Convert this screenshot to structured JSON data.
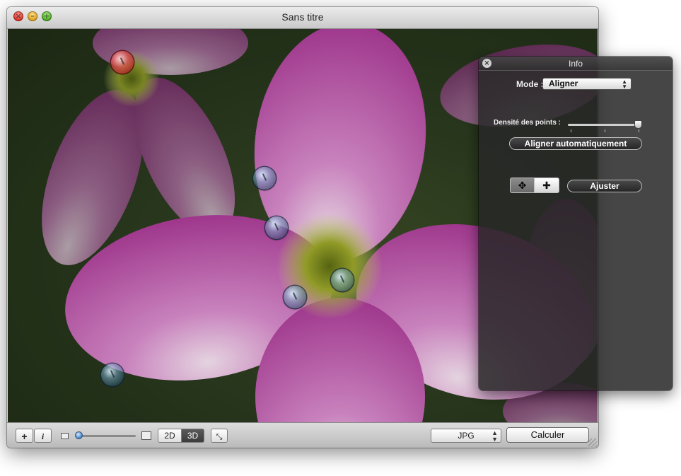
{
  "window": {
    "title": "Sans titre"
  },
  "toolbar": {
    "add_label": "+",
    "info_label": "i",
    "view_2d_label": "2D",
    "view_3d_label": "3D",
    "active_view": "3D",
    "format_value": "JPG",
    "calculate_label": "Calculer",
    "zoom_level": 0.0
  },
  "info_panel": {
    "title": "Info",
    "mode_label": "Mode :",
    "mode_value": "Aligner",
    "density_label": "Densité des points :",
    "density_value": 1.0,
    "auto_align_label": "Aligner automatiquement",
    "adjust_label": "Ajuster",
    "tools": [
      {
        "name": "move-points-tool",
        "glyph": "✥",
        "active": true
      },
      {
        "name": "add-point-tool",
        "glyph": "✚",
        "active": false
      }
    ]
  },
  "colors": {
    "petal": "#b4489f",
    "petal_light": "#d58ac9",
    "flower_center": "#9aa52a",
    "background": "#2a3a1e",
    "hud_background": "#282828",
    "selected_point": "#d23b3b",
    "control_point": "#6fa0c0"
  }
}
